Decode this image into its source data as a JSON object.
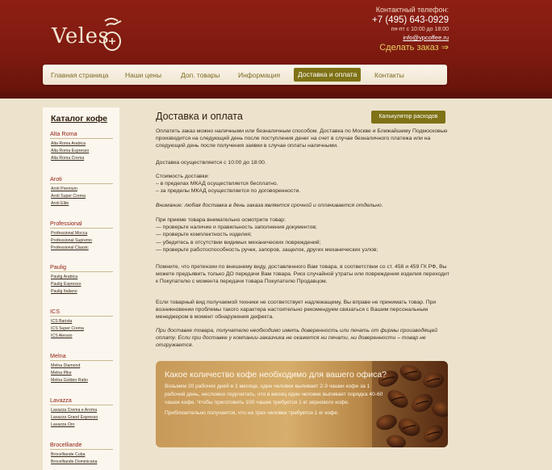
{
  "header": {
    "logo_text": "Veles",
    "contact_label": "Контактный телефон:",
    "phone": "+7 (495) 643-0929",
    "hours": "пн-пт с 10:00 до 18:00",
    "email": "info@vpcoffee.ru",
    "order_link": "Сделать заказ ⇒"
  },
  "nav": {
    "items": [
      {
        "label": "Главная страница"
      },
      {
        "label": "Наши цены"
      },
      {
        "label": "Доп. товары"
      },
      {
        "label": "Информация"
      },
      {
        "label": "Доставка и оплата"
      },
      {
        "label": "Контакты"
      }
    ],
    "active": "Доставка и оплата"
  },
  "sidebar": {
    "title": "Каталог кофе",
    "categories": [
      {
        "name": "Alta Roma",
        "items": [
          "Alta Roma Arabica",
          "Alta Roma Espresso",
          "Alta Roma Crema"
        ]
      },
      {
        "name": "Aroti",
        "items": [
          "Aroti Premium",
          "Aroti Super Crema",
          "Aroti Elite"
        ]
      },
      {
        "name": "Professional",
        "items": [
          "Professional Mocca",
          "Professional Supremo",
          "Professional Classic"
        ]
      },
      {
        "name": "Paulig",
        "items": [
          "Paulig Arabica",
          "Paulig Espresso",
          "Paulig Italiano"
        ]
      },
      {
        "name": "ICS",
        "items": [
          "ICS Barista",
          "ICS Super Crema",
          "ICS Alessio"
        ]
      },
      {
        "name": "Melna",
        "items": [
          "Melna Diamond",
          "Melna Pike",
          "Melna Golden Ratio"
        ]
      },
      {
        "name": "Lavazza",
        "items": [
          "Lavazza Crema e Aroma",
          "Lavazza Grand Espresso",
          "Lavazza Oro"
        ]
      },
      {
        "name": "Brocelliande",
        "items": [
          "Brocelliande Cuba",
          "Brocelliande Dominicana"
        ]
      }
    ]
  },
  "main": {
    "title": "Доставка и оплата",
    "calc_button": "Калькулятор расходов",
    "p1": "Оплатить заказ можно наличными или безналичным способом. Доставка по Москве и Ближайшему Подмосковью производится на следующий день после поступления денег на счет в случае безналичного платежа или на следующий день после получения заявки в случае оплаты наличными.",
    "p2": "Доставка осуществляется с 10:00 до 18:00.",
    "p3_title": "Стоимость доставки:",
    "p3_l1": "– в пределах МКАД осуществляется бесплатно.",
    "p3_l2": "– за пределы МКАД осуществляется по договоренности.",
    "p4": "Внимание: любая доставка в день заказа является срочной и оплачивается отдельно.",
    "p5_title": "При приеме товара внимательно осмотрите товар:",
    "p5_l1": "— проверьте наличие и правильность заполнения документов;",
    "p5_l2": "— проверьте комплектность изделия;",
    "p5_l3": "— убедитесь в отсутствии видимых механических повреждений;",
    "p5_l4": "— проверьте работоспособность ручек, запоров, защелок, других механических узлов;",
    "p6": "Помните, что претензии по внешнему виду, доставленного Вам товара, в соответствии со ст. 458 и 459 ГК РФ, Вы можете предъявить только ДО передачи Вам товара. Риск случайной утраты или повреждения изделия переходит к Покупателю с момента передачи товара Покупателю Продавцом.",
    "p7": "Если товарный вид получаемой техники не соответствует надлежащему, Вы вправе не принимать товар. При возникновении проблемы такого характера настоятельно рекомендуем связаться с Вашим персональным менеджером в момент обнаружения дефекта.",
    "p8": "При доставке товара, получателю необходимо иметь доверенность или печать от фирмы производящей оплату. Если при доставке у компании-заказчика не окажется ни печати, ни доверенности – товар не отгружается."
  },
  "banner": {
    "title": "Какое количество кофе необходимо для вашего офиса?",
    "t1": "Возьмем 20 рабочих дней в 1 месяце, один человек выпивает 2-3 чашки кофе за 1 рабочий день, несложно подсчитать, что в месяц один человек выпивает порядка 40-60 чашек кофе. Чтобы приготовить 100 чашек требуется 1 кг зернового кофе.",
    "t2": "Приблизительно получается, что на трех человек требуется 1 кг кофе."
  },
  "colors": {
    "header_red": "#7d1a10",
    "accent_olive": "#7f7216",
    "link_red": "#8f1a10",
    "order_yellow": "#e7cf63"
  }
}
